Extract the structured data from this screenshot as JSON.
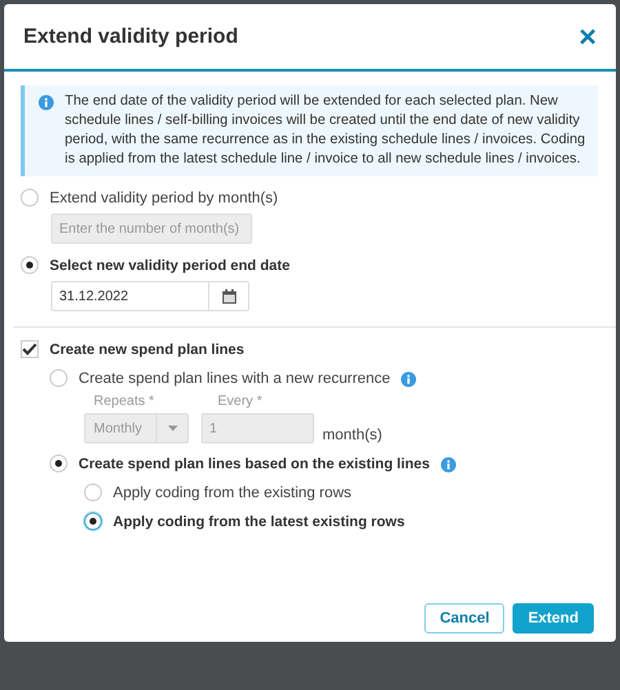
{
  "dialog": {
    "title": "Extend validity period",
    "close": "×"
  },
  "info": "The end date of the validity period will be extended for each selected plan. New schedule lines / self-billing invoices will be created until the end date of new validity period, with the same recurrence as in the existing schedule lines / invoices. Coding is applied from the latest schedule line / invoice to all new schedule lines / invoices.",
  "period_options": [
    {
      "label": "Extend validity period by month(s)",
      "selected": false,
      "field": {
        "kind": "text",
        "placeholder": "Enter the number of month(s)",
        "disabled": true
      }
    },
    {
      "label": "Select new validity period end date",
      "selected": true,
      "field": {
        "kind": "date",
        "value": "31.12.2022",
        "disabled": false
      }
    }
  ],
  "create_lines": {
    "label": "Create new spend plan lines",
    "checked": true,
    "options": [
      {
        "label": "Create spend plan lines with a new recurrence",
        "selected": false,
        "info_icon": true,
        "repeats_label": "Repeats *",
        "repeats_value": "Monthly",
        "every_label": "Every *",
        "every_value": "1",
        "unit": "month(s)"
      },
      {
        "label": "Create spend plan lines based on the existing lines",
        "selected": true,
        "info_icon": true,
        "suboptions": [
          {
            "label": "Apply coding from the existing rows",
            "selected": false
          },
          {
            "label": "Apply coding from the latest existing rows",
            "selected": true
          }
        ]
      }
    ]
  },
  "buttons": [
    {
      "label": "Cancel",
      "kind": "secondary"
    },
    {
      "label": "Extend",
      "kind": "primary"
    }
  ]
}
